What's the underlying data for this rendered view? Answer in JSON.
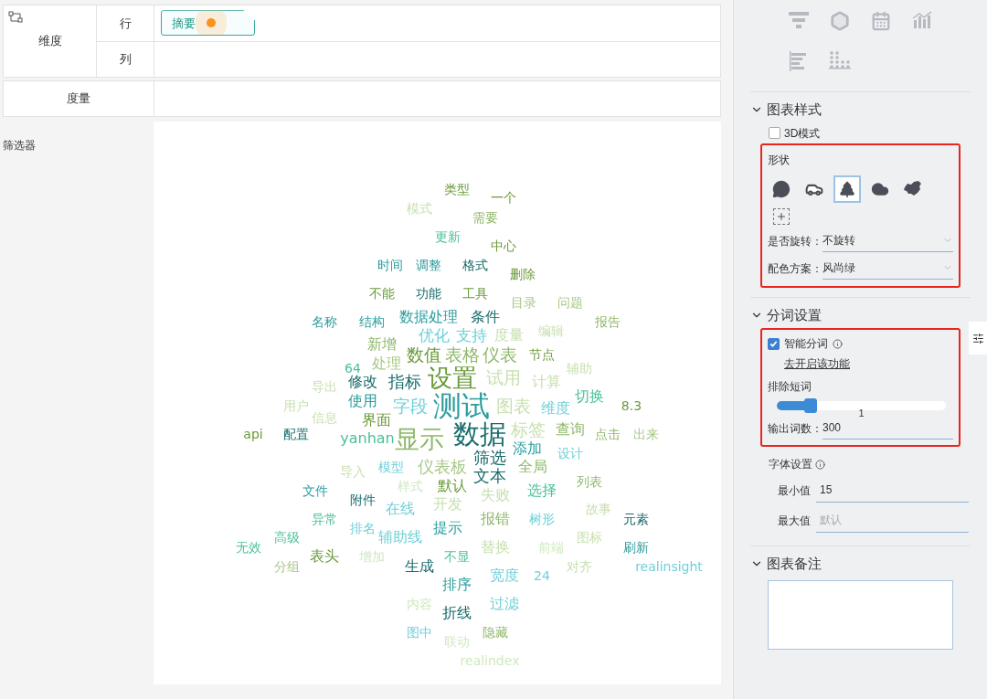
{
  "dimensions": {
    "label": "维度",
    "rows_label": "行",
    "columns_label": "列",
    "row_fields": [
      {
        "label": "摘要"
      }
    ]
  },
  "measures": {
    "label": "度量"
  },
  "filters": {
    "label": "筛选器"
  },
  "word_cloud": {
    "words": [
      {
        "text": "类型",
        "color": "#6a9a3a"
      },
      {
        "text": "一个",
        "color": "#6a9a3a"
      },
      {
        "text": "模式",
        "color": "#c8e0b0"
      },
      {
        "text": "需要",
        "color": "#8fb86a"
      },
      {
        "text": "更新",
        "color": "#4cbf9a"
      },
      {
        "text": "中心",
        "color": "#6a9a3a"
      },
      {
        "text": "时间",
        "color": "#2a9d9d"
      },
      {
        "text": "调整",
        "color": "#2a9d9d"
      },
      {
        "text": "格式",
        "color": "#1a6b6b"
      },
      {
        "text": "删除",
        "color": "#6a9a3a"
      },
      {
        "text": "不能",
        "color": "#6a9a3a"
      },
      {
        "text": "功能",
        "color": "#1a6b6b"
      },
      {
        "text": "工具",
        "color": "#6a9a3a"
      },
      {
        "text": "目录",
        "color": "#a8c888"
      },
      {
        "text": "问题",
        "color": "#a8c888"
      },
      {
        "text": "名称",
        "color": "#2a9d9d"
      },
      {
        "text": "结构",
        "color": "#2a9d9d"
      },
      {
        "text": "数据处理",
        "color": "#2a9d9d"
      },
      {
        "text": "条件",
        "color": "#1a6b6b"
      },
      {
        "text": "报告",
        "color": "#8fb86a"
      },
      {
        "text": "优化",
        "color": "#6fd0d8"
      },
      {
        "text": "支持",
        "color": "#6fd0d8"
      },
      {
        "text": "度量",
        "color": "#c8e0b0"
      },
      {
        "text": "编辑",
        "color": "#c8e0b0"
      },
      {
        "text": "新增",
        "color": "#8fb86a"
      },
      {
        "text": "数值",
        "color": "#6a9a3a"
      },
      {
        "text": "表格",
        "color": "#8fb86a"
      },
      {
        "text": "仪表",
        "color": "#8fb86a"
      },
      {
        "text": "节点",
        "color": "#6a9a3a"
      },
      {
        "text": "64",
        "color": "#4cbf9a"
      },
      {
        "text": "处理",
        "color": "#a8c888"
      },
      {
        "text": "辅助",
        "color": "#c8e0b0"
      },
      {
        "text": "导出",
        "color": "#c8e0b0"
      },
      {
        "text": "修改",
        "color": "#1a6b6b"
      },
      {
        "text": "指标",
        "color": "#1a6b6b"
      },
      {
        "text": "设置",
        "color": "#6a9a3a"
      },
      {
        "text": "试用",
        "color": "#c8e0b0"
      },
      {
        "text": "计算",
        "color": "#c8e0b0"
      },
      {
        "text": "切换",
        "color": "#4cbf9a"
      },
      {
        "text": "用户",
        "color": "#c8e0b0"
      },
      {
        "text": "使用",
        "color": "#2a9d9d"
      },
      {
        "text": "字段",
        "color": "#6fd0d8"
      },
      {
        "text": "测试",
        "color": "#2a9d9d"
      },
      {
        "text": "图表",
        "color": "#c8e0b0"
      },
      {
        "text": "维度",
        "color": "#6fd0d8"
      },
      {
        "text": "8.3",
        "color": "#6a9a3a"
      },
      {
        "text": "信息",
        "color": "#c8e0b0"
      },
      {
        "text": "界面",
        "color": "#6a9a3a"
      },
      {
        "text": "api",
        "color": "#6a9a3a"
      },
      {
        "text": "配置",
        "color": "#1a6b6b"
      },
      {
        "text": "yanhan",
        "color": "#4cbf9a"
      },
      {
        "text": "显示",
        "color": "#8fb86a"
      },
      {
        "text": "数据",
        "color": "#1a6b6b"
      },
      {
        "text": "标签",
        "color": "#c8e0b0"
      },
      {
        "text": "查询",
        "color": "#8fb86a"
      },
      {
        "text": "点击",
        "color": "#8fb86a"
      },
      {
        "text": "出来",
        "color": "#a8c888"
      },
      {
        "text": "筛选",
        "color": "#1a6b6b"
      },
      {
        "text": "添加",
        "color": "#2a9d9d"
      },
      {
        "text": "设计",
        "color": "#6fd0d8"
      },
      {
        "text": "导入",
        "color": "#c8e0b0"
      },
      {
        "text": "模型",
        "color": "#6fd0d8"
      },
      {
        "text": "仪表板",
        "color": "#a8c888"
      },
      {
        "text": "文本",
        "color": "#1a6b6b"
      },
      {
        "text": "全局",
        "color": "#8fb86a"
      },
      {
        "text": "列表",
        "color": "#8fb86a"
      },
      {
        "text": "文件",
        "color": "#2a9d9d"
      },
      {
        "text": "附件",
        "color": "#1a6b6b"
      },
      {
        "text": "样式",
        "color": "#d0e8c0"
      },
      {
        "text": "默认",
        "color": "#6a9a3a"
      },
      {
        "text": "失败",
        "color": "#c8e0b0"
      },
      {
        "text": "选择",
        "color": "#4cbf9a"
      },
      {
        "text": "在线",
        "color": "#6fd0d8"
      },
      {
        "text": "开发",
        "color": "#c8e0b0"
      },
      {
        "text": "故事",
        "color": "#c8e0b0"
      },
      {
        "text": "异常",
        "color": "#4cbf9a"
      },
      {
        "text": "排名",
        "color": "#6fd0d8"
      },
      {
        "text": "提示",
        "color": "#2a9d9d"
      },
      {
        "text": "报错",
        "color": "#8fb86a"
      },
      {
        "text": "树形",
        "color": "#6fd0d8"
      },
      {
        "text": "元素",
        "color": "#1a6b6b"
      },
      {
        "text": "无效",
        "color": "#4cbf9a"
      },
      {
        "text": "高级",
        "color": "#4cbf9a"
      },
      {
        "text": "辅助线",
        "color": "#6fd0d8"
      },
      {
        "text": "替换",
        "color": "#c8e0b0"
      },
      {
        "text": "前端",
        "color": "#d0e8c0"
      },
      {
        "text": "图标",
        "color": "#c8e0b0"
      },
      {
        "text": "刷新",
        "color": "#2a9d9d"
      },
      {
        "text": "分组",
        "color": "#a8c888"
      },
      {
        "text": "表头",
        "color": "#6a9a3a"
      },
      {
        "text": "增加",
        "color": "#d0e8c0"
      },
      {
        "text": "生成",
        "color": "#1a6b6b"
      },
      {
        "text": "不显",
        "color": "#4cbf9a"
      },
      {
        "text": "对齐",
        "color": "#c8e0b0"
      },
      {
        "text": "realinsight",
        "color": "#6fd0d8"
      },
      {
        "text": "排序",
        "color": "#2a9d9d"
      },
      {
        "text": "宽度",
        "color": "#6fd0d8"
      },
      {
        "text": "24",
        "color": "#6fd0d8"
      },
      {
        "text": "内容",
        "color": "#d0e8c0"
      },
      {
        "text": "折线",
        "color": "#1a6b6b"
      },
      {
        "text": "过滤",
        "color": "#6fd0d8"
      },
      {
        "text": "图中",
        "color": "#6fd0d8"
      },
      {
        "text": "联动",
        "color": "#d0e8c0"
      },
      {
        "text": "隐藏",
        "color": "#8fb86a"
      },
      {
        "text": "realindex",
        "color": "#d0e8c0"
      }
    ]
  },
  "chart_types": [
    {
      "kind": "funnel"
    },
    {
      "kind": "hexagon"
    },
    {
      "kind": "calendar"
    },
    {
      "kind": "bar-line"
    },
    {
      "kind": "hbar"
    },
    {
      "kind": "pictogram"
    }
  ],
  "chart_style": {
    "title": "图表样式",
    "expanded": true,
    "mode_3d": {
      "label": "3D模式",
      "checked": false
    },
    "shape_group": {
      "highlighted": true,
      "label": "形状",
      "shapes": [
        {
          "kind": "bubble",
          "selected": false
        },
        {
          "kind": "car",
          "selected": false
        },
        {
          "kind": "tree",
          "selected": true
        },
        {
          "kind": "cloud",
          "selected": false
        },
        {
          "kind": "map",
          "selected": false
        },
        {
          "kind": "add",
          "selected": false
        }
      ],
      "rotation": {
        "label": "是否旋转：",
        "value": "不旋转"
      },
      "palette": {
        "label": "配色方案：",
        "value": "风尚绿"
      }
    }
  },
  "segmentation": {
    "title": "分词设置",
    "expanded": true,
    "smart_group": {
      "highlighted": true,
      "smart": {
        "label": "智能分词",
        "checked": true
      },
      "link": "去开启该功能",
      "exclude_label": "排除短词",
      "exclude_slider": {
        "level": 0.2,
        "reading": "1"
      },
      "output": {
        "label": "输出词数：",
        "value": "300"
      }
    },
    "font": {
      "label": "字体设置",
      "min": {
        "label": "最小值",
        "value": "15"
      },
      "max": {
        "label": "最大值",
        "placeholder": "默认"
      }
    }
  },
  "notes": {
    "title": "图表备注",
    "expanded": true
  }
}
